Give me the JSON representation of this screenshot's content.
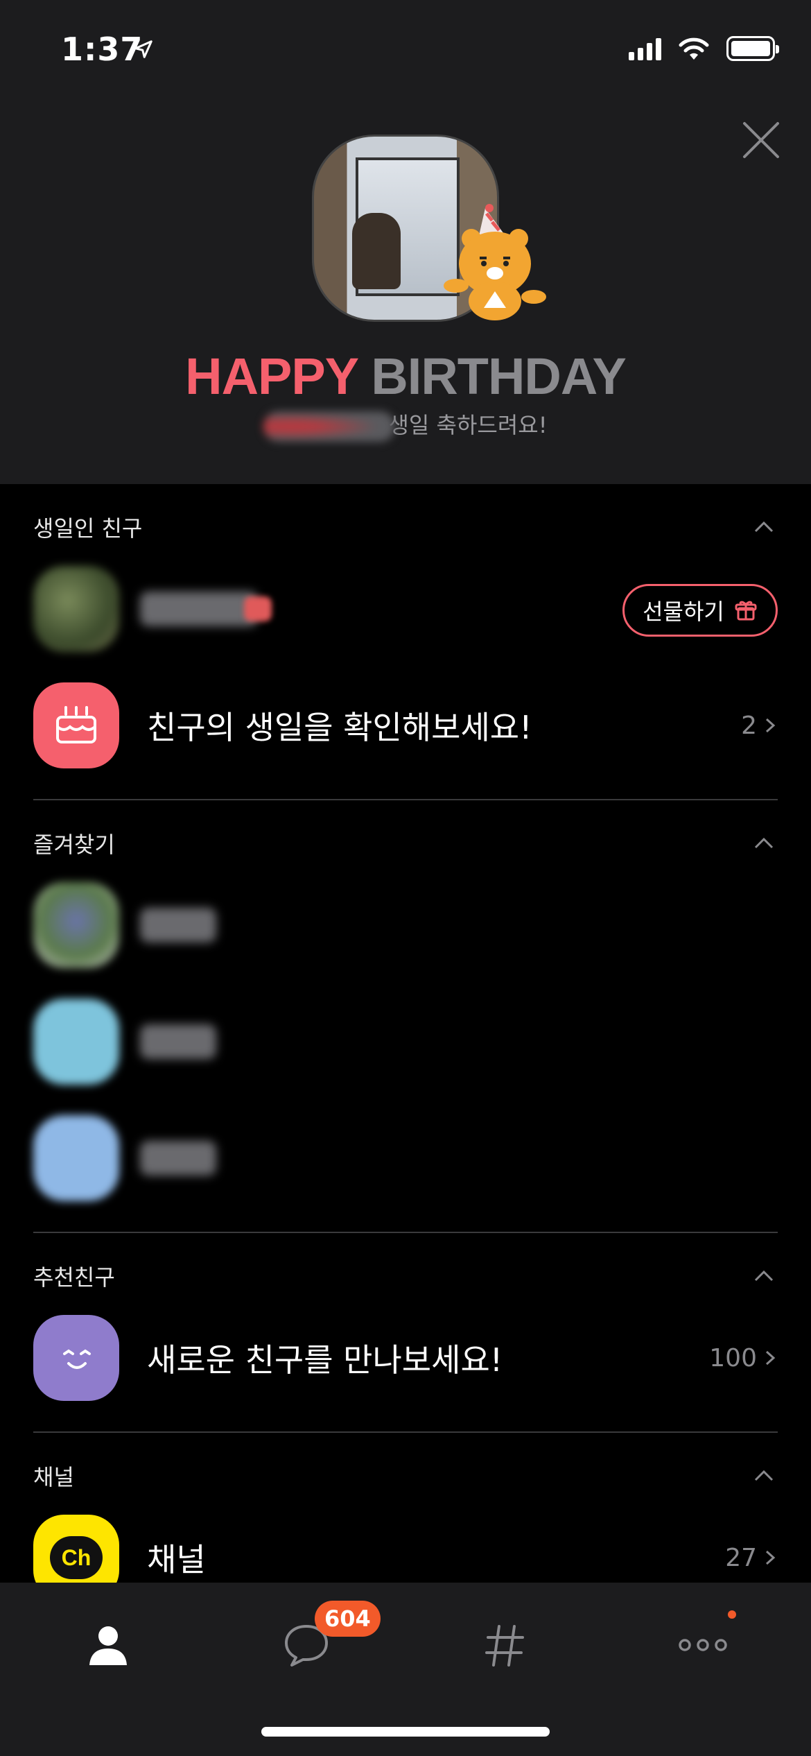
{
  "status_bar": {
    "time": "1:37"
  },
  "banner": {
    "title_happy": "HAPPY",
    "title_birthday": "BIRTHDAY",
    "subtitle": "생일 축하드려요!"
  },
  "sections": {
    "birthday": {
      "title": "생일인 친구",
      "gift_label": "선물하기",
      "check_label": "친구의 생일을 확인해보세요!",
      "check_count": "2"
    },
    "favorites": {
      "title": "즐겨찾기"
    },
    "recommended": {
      "title": "추천친구",
      "label": "새로운 친구를 만나보세요!",
      "count": "100"
    },
    "channel": {
      "title": "채널",
      "label": "채널",
      "count": "27",
      "logo_text": "Ch"
    }
  },
  "tabbar": {
    "chat_badge": "604"
  },
  "colors": {
    "accent_red": "#f5606d",
    "badge_orange": "#f25a2a",
    "channel_yellow": "#fee500",
    "recommend_purple": "#8f7ccc",
    "background": "#000000",
    "banner_bg": "#1c1c1e"
  },
  "icons": [
    "location-arrow-icon",
    "signal-icon",
    "wifi-icon",
    "battery-icon",
    "close-icon",
    "chevron-up-icon",
    "gift-icon",
    "cake-icon",
    "chevron-right-icon",
    "smile-icon",
    "person-tab-icon",
    "chat-tab-icon",
    "hashtag-tab-icon",
    "more-tab-icon"
  ]
}
